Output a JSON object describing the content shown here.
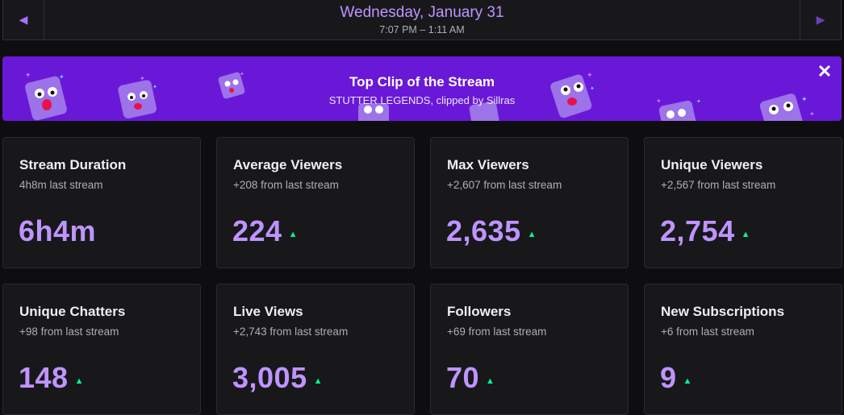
{
  "datebar": {
    "title": "Wednesday, January 31",
    "time_range": "7:07 PM – 1:11 AM",
    "prev_icon": "chevron-left-icon",
    "next_icon": "chevron-right-icon"
  },
  "banner": {
    "title": "Top Clip of the Stream",
    "subtitle": "STUTTER LEGENDS, clipped by Sillras",
    "close_icon": "close-icon",
    "background": "#6a18d8"
  },
  "stats": [
    {
      "title": "Stream Duration",
      "subtitle": "4h8m last stream",
      "value": "6h4m",
      "trend": ""
    },
    {
      "title": "Average Viewers",
      "subtitle": "+208 from last stream",
      "value": "224",
      "trend": "up"
    },
    {
      "title": "Max Viewers",
      "subtitle": "+2,607 from last stream",
      "value": "2,635",
      "trend": "up"
    },
    {
      "title": "Unique Viewers",
      "subtitle": "+2,567 from last stream",
      "value": "2,754",
      "trend": "up"
    },
    {
      "title": "Unique Chatters",
      "subtitle": "+98 from last stream",
      "value": "148",
      "trend": "up"
    },
    {
      "title": "Live Views",
      "subtitle": "+2,743 from last stream",
      "value": "3,005",
      "trend": "up"
    },
    {
      "title": "Followers",
      "subtitle": "+69 from last stream",
      "value": "70",
      "trend": "up"
    },
    {
      "title": "New Subscriptions",
      "subtitle": "+6 from last stream",
      "value": "9",
      "trend": "up"
    }
  ],
  "colors": {
    "accent": "#bf94ff",
    "trend_up": "#00f593",
    "card_bg": "#18181b",
    "page_bg": "#0e0e10"
  }
}
